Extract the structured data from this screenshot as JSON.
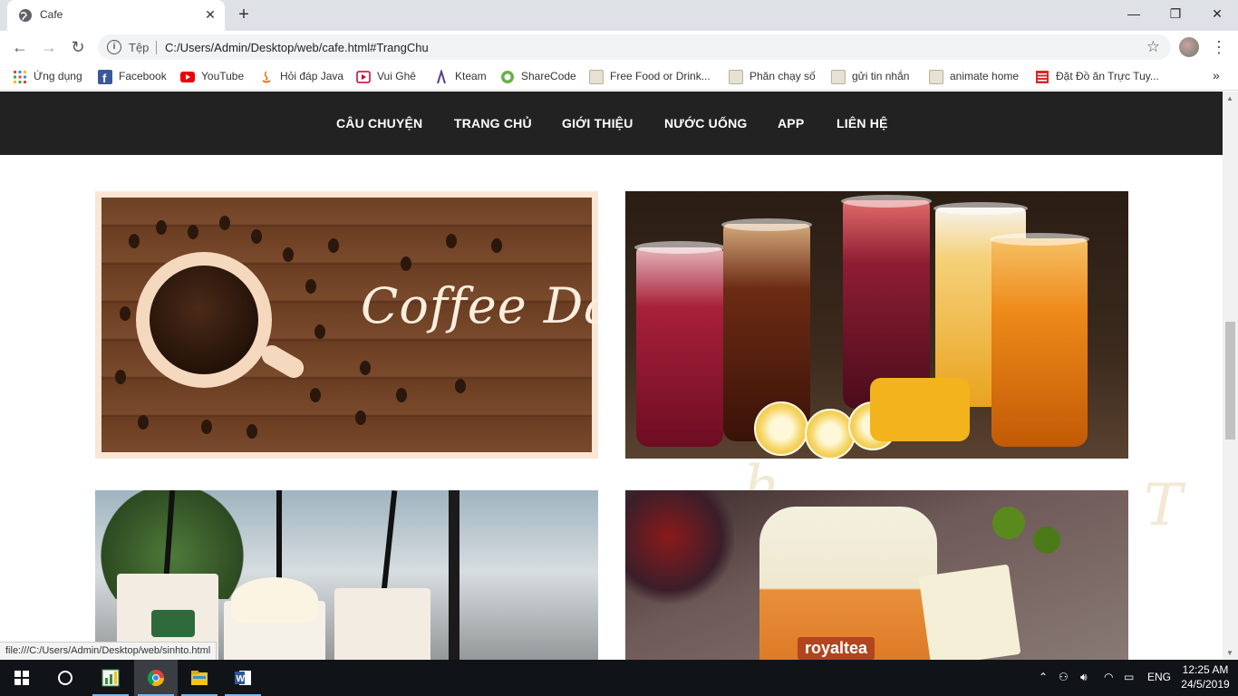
{
  "browser": {
    "tab_title": "Cafe",
    "new_tab_symbol": "+",
    "omnibox_label": "Tệp",
    "url": "C:/Users/Admin/Desktop/web/cafe.html#TrangChu",
    "status_url": "file:///C:/Users/Admin/Desktop/web/sinhto.html",
    "bookmarks": [
      {
        "label": "Ứng dụng",
        "icon": "apps-grid-icon"
      },
      {
        "label": "Facebook",
        "icon": "facebook-icon"
      },
      {
        "label": "YouTube",
        "icon": "youtube-icon"
      },
      {
        "label": "Hỏi đáp Java",
        "icon": "java-icon"
      },
      {
        "label": "Vui Ghê",
        "icon": "play-icon"
      },
      {
        "label": "Kteam",
        "icon": "kteam-icon"
      },
      {
        "label": "ShareCode",
        "icon": "sharecode-icon"
      },
      {
        "label": "Free Food or Drink...",
        "icon": "folder-icon"
      },
      {
        "label": "Phăn chạy số",
        "icon": "folder-icon"
      },
      {
        "label": "gửi tin nhắn",
        "icon": "folder-icon"
      },
      {
        "label": "animate home",
        "icon": "folder-icon"
      },
      {
        "label": "Đặt Đồ ăn Trực Tuy...",
        "icon": "menu-icon"
      }
    ],
    "more_bookmarks": "»"
  },
  "site": {
    "nav": [
      "CÂU CHUYỆN",
      "TRANG CHỦ",
      "GIỚI THIỆU",
      "NƯỚC UỐNG",
      "APP",
      "LIÊN HỆ"
    ],
    "banner_text": "Coffee Day",
    "product_label": "royaltea"
  },
  "taskbar": {
    "language": "ENG",
    "time": "12:25 AM",
    "date": "24/5/2019"
  }
}
